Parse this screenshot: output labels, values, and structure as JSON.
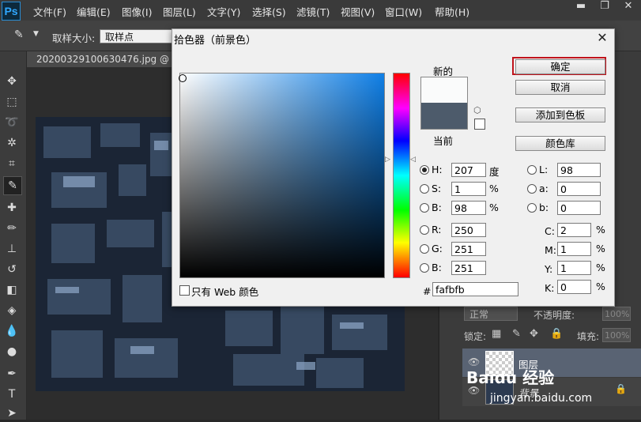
{
  "app": {
    "logo": "Ps"
  },
  "menu": [
    "文件(F)",
    "编辑(E)",
    "图像(I)",
    "图层(L)",
    "文字(Y)",
    "选择(S)",
    "滤镜(T)",
    "视图(V)",
    "窗口(W)",
    "帮助(H)"
  ],
  "options": {
    "sample_size_label": "取样大小:",
    "sample_size_value": "取样点"
  },
  "document": {
    "tab_title": "20200329100630476.jpg @ 100"
  },
  "dialog": {
    "title": "拾色器（前景色）",
    "new_label": "新的",
    "current_label": "当前",
    "new_color": "#fafbfb",
    "current_color": "#4d5b6b",
    "buttons": {
      "ok": "确定",
      "cancel": "取消",
      "add_swatch": "添加到色板",
      "color_library": "颜色库"
    },
    "hsb": [
      {
        "label": "H:",
        "value": "207",
        "unit": "度",
        "selected": true
      },
      {
        "label": "S:",
        "value": "1",
        "unit": "%",
        "selected": false
      },
      {
        "label": "B:",
        "value": "98",
        "unit": "%",
        "selected": false
      }
    ],
    "rgb": [
      {
        "label": "R:",
        "value": "250"
      },
      {
        "label": "G:",
        "value": "251"
      },
      {
        "label": "B:",
        "value": "251"
      }
    ],
    "lab": [
      {
        "label": "L:",
        "value": "98"
      },
      {
        "label": "a:",
        "value": "0"
      },
      {
        "label": "b:",
        "value": "0"
      }
    ],
    "cmyk": [
      {
        "label": "C:",
        "value": "2",
        "unit": "%"
      },
      {
        "label": "M:",
        "value": "1",
        "unit": "%"
      },
      {
        "label": "Y:",
        "value": "1",
        "unit": "%"
      },
      {
        "label": "K:",
        "value": "0",
        "unit": "%"
      }
    ],
    "hex_label": "#",
    "hex_value": "fafbfb",
    "web_only_label": "只有 Web 颜色"
  },
  "layers_panel": {
    "blend_mode": "正常",
    "opacity_label": "不透明度:",
    "opacity_value": "100%",
    "lock_label": "锁定:",
    "fill_label": "填充:",
    "fill_value": "100%",
    "layers": [
      "图层",
      "背景"
    ]
  },
  "watermark": {
    "line1": "Baidu 经验",
    "line2": "jingyan.baidu.com"
  }
}
